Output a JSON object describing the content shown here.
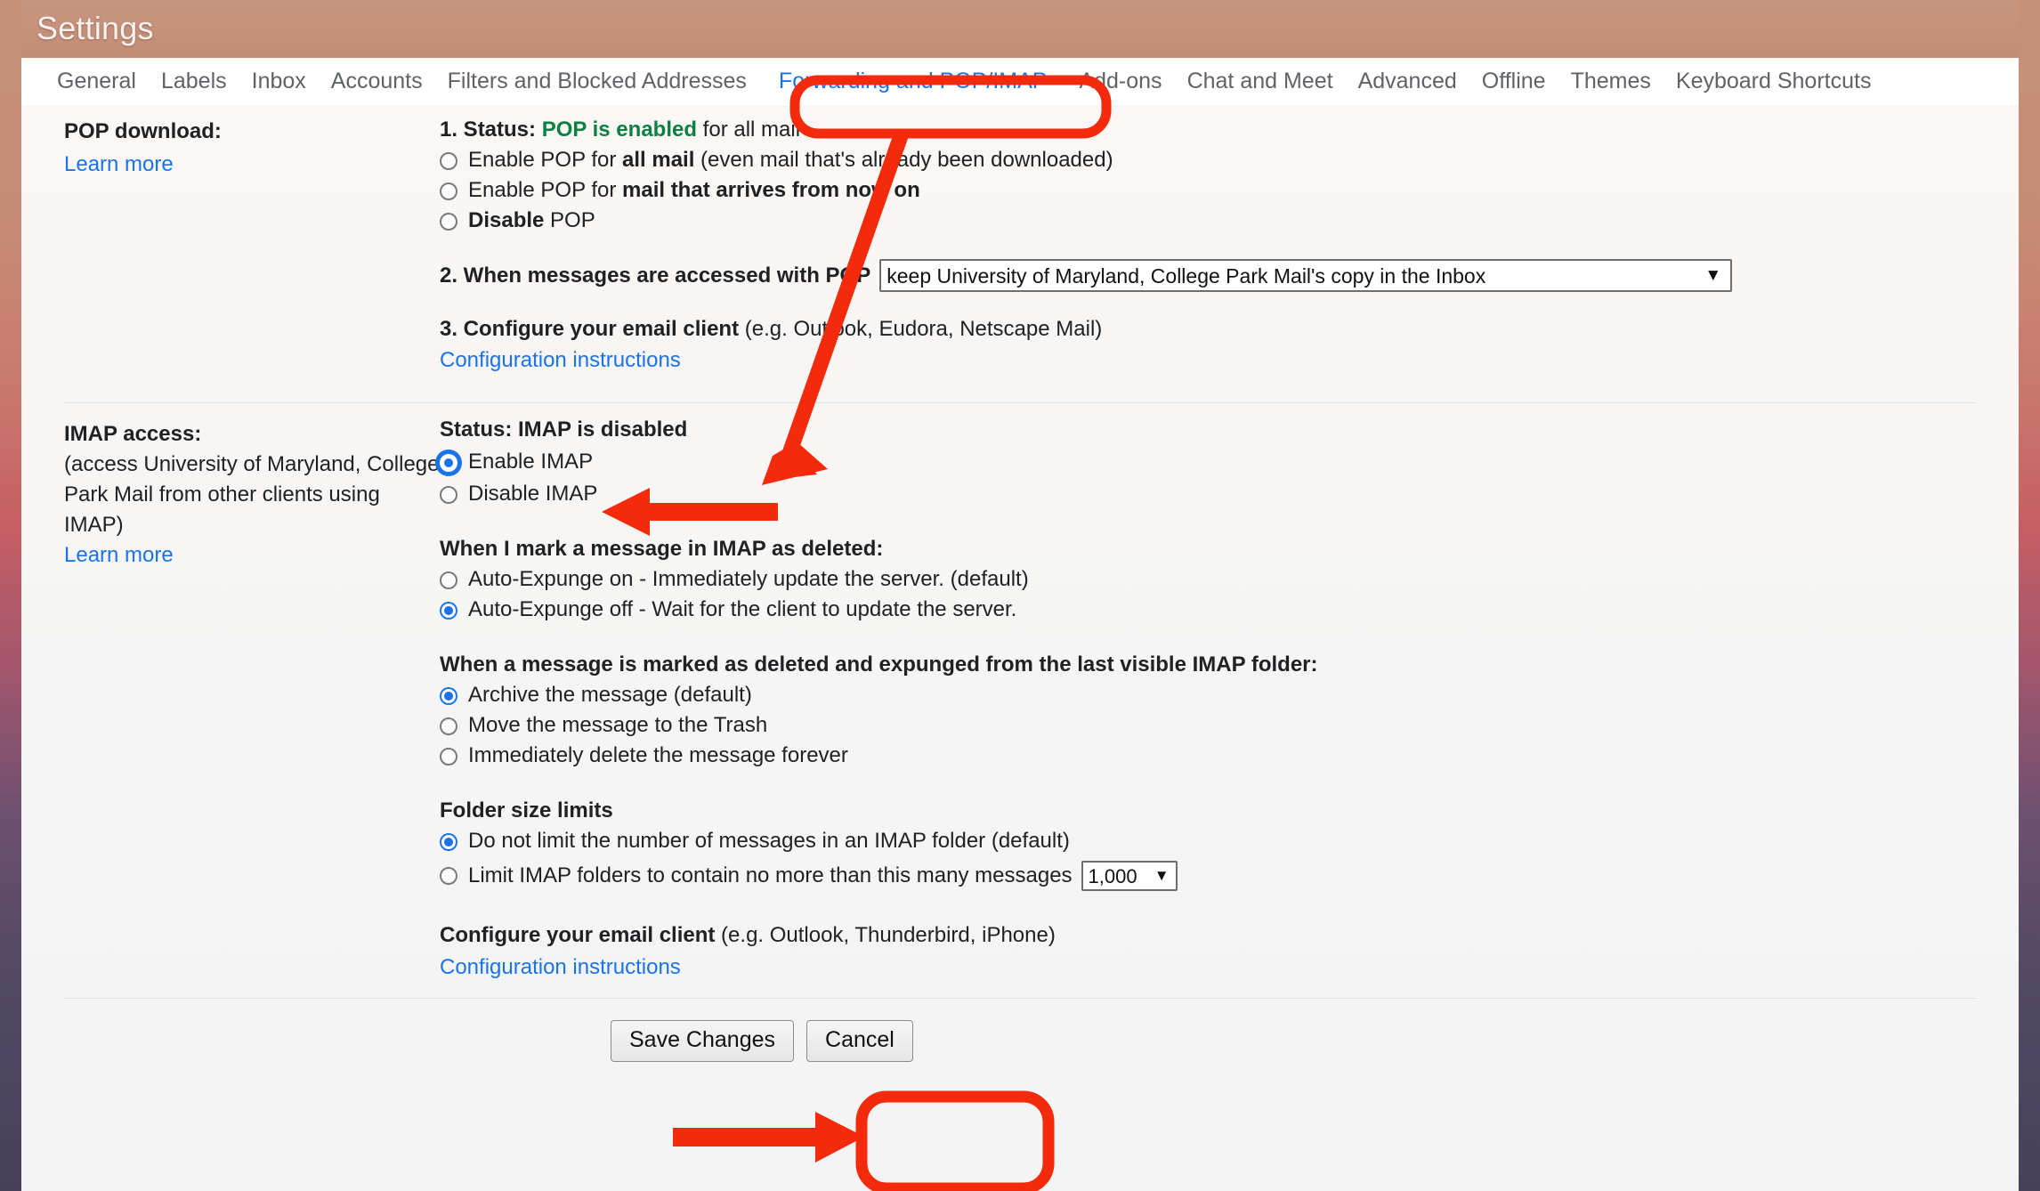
{
  "window": {
    "title": "Settings"
  },
  "tabs": [
    {
      "label": "General",
      "active": false
    },
    {
      "label": "Labels",
      "active": false
    },
    {
      "label": "Inbox",
      "active": false
    },
    {
      "label": "Accounts",
      "active": false
    },
    {
      "label": "Filters and Blocked Addresses",
      "active": false
    },
    {
      "label": "Forwarding and POP/IMAP",
      "active": true
    },
    {
      "label": "Add-ons",
      "active": false
    },
    {
      "label": "Chat and Meet",
      "active": false
    },
    {
      "label": "Advanced",
      "active": false
    },
    {
      "label": "Offline",
      "active": false
    },
    {
      "label": "Themes",
      "active": false
    },
    {
      "label": "Keyboard Shortcuts",
      "active": false
    }
  ],
  "pop": {
    "section_label": "POP download:",
    "learn_more": "Learn more",
    "status_prefix": "1. Status:",
    "status_value": "POP is enabled",
    "status_suffix": "for all mail",
    "options": [
      {
        "pre": "Enable POP for ",
        "bold": "all mail",
        "post": " (even mail that's already been downloaded)",
        "selected": false
      },
      {
        "pre": "Enable POP for ",
        "bold": "mail that arrives from now on",
        "post": "",
        "selected": false
      },
      {
        "pre": "",
        "bold": "Disable",
        "post": " POP",
        "selected": false
      }
    ],
    "step2_label": "2. When messages are accessed with POP",
    "step2_select_value": "keep University of Maryland, College Park Mail's copy in the Inbox",
    "step3_bold": "3. Configure your email client",
    "step3_rest": " (e.g. Outlook, Eudora, Netscape Mail)",
    "config_link": "Configuration instructions"
  },
  "imap": {
    "section_label": "IMAP access:",
    "section_sub_line1": "(access University of Maryland, College",
    "section_sub_line2": "Park Mail from other clients using IMAP)",
    "learn_more": "Learn more",
    "status": "Status: IMAP is disabled",
    "toggle_options": [
      {
        "label": "Enable IMAP",
        "selected": true,
        "focused": true
      },
      {
        "label": "Disable IMAP",
        "selected": false,
        "focused": false
      }
    ],
    "expunge_title": "When I mark a message in IMAP as deleted:",
    "expunge_options": [
      {
        "label": "Auto-Expunge on - Immediately update the server. (default)",
        "selected": false
      },
      {
        "label": "Auto-Expunge off - Wait for the client to update the server.",
        "selected": true
      }
    ],
    "deleted_title": "When a message is marked as deleted and expunged from the last visible IMAP folder:",
    "deleted_options": [
      {
        "label": "Archive the message (default)",
        "selected": true
      },
      {
        "label": "Move the message to the Trash",
        "selected": false
      },
      {
        "label": "Immediately delete the message forever",
        "selected": false
      }
    ],
    "folder_size_title": "Folder size limits",
    "folder_size_options": [
      {
        "label": "Do not limit the number of messages in an IMAP folder (default)",
        "selected": true
      },
      {
        "label": "Limit IMAP folders to contain no more than this many messages",
        "selected": false
      }
    ],
    "limit_select_value": "1,000",
    "configure_bold": "Configure your email client",
    "configure_rest": " (e.g. Outlook, Thunderbird, iPhone)",
    "config_link": "Configuration instructions"
  },
  "footer": {
    "save_label": "Save Changes",
    "cancel_label": "Cancel"
  },
  "annotations": {
    "accent_color": "#f42a0c",
    "highlighted_tab": "Forwarding and POP/IMAP",
    "highlighted_button": "Save Changes",
    "arrow_target_radio": "Enable IMAP"
  }
}
